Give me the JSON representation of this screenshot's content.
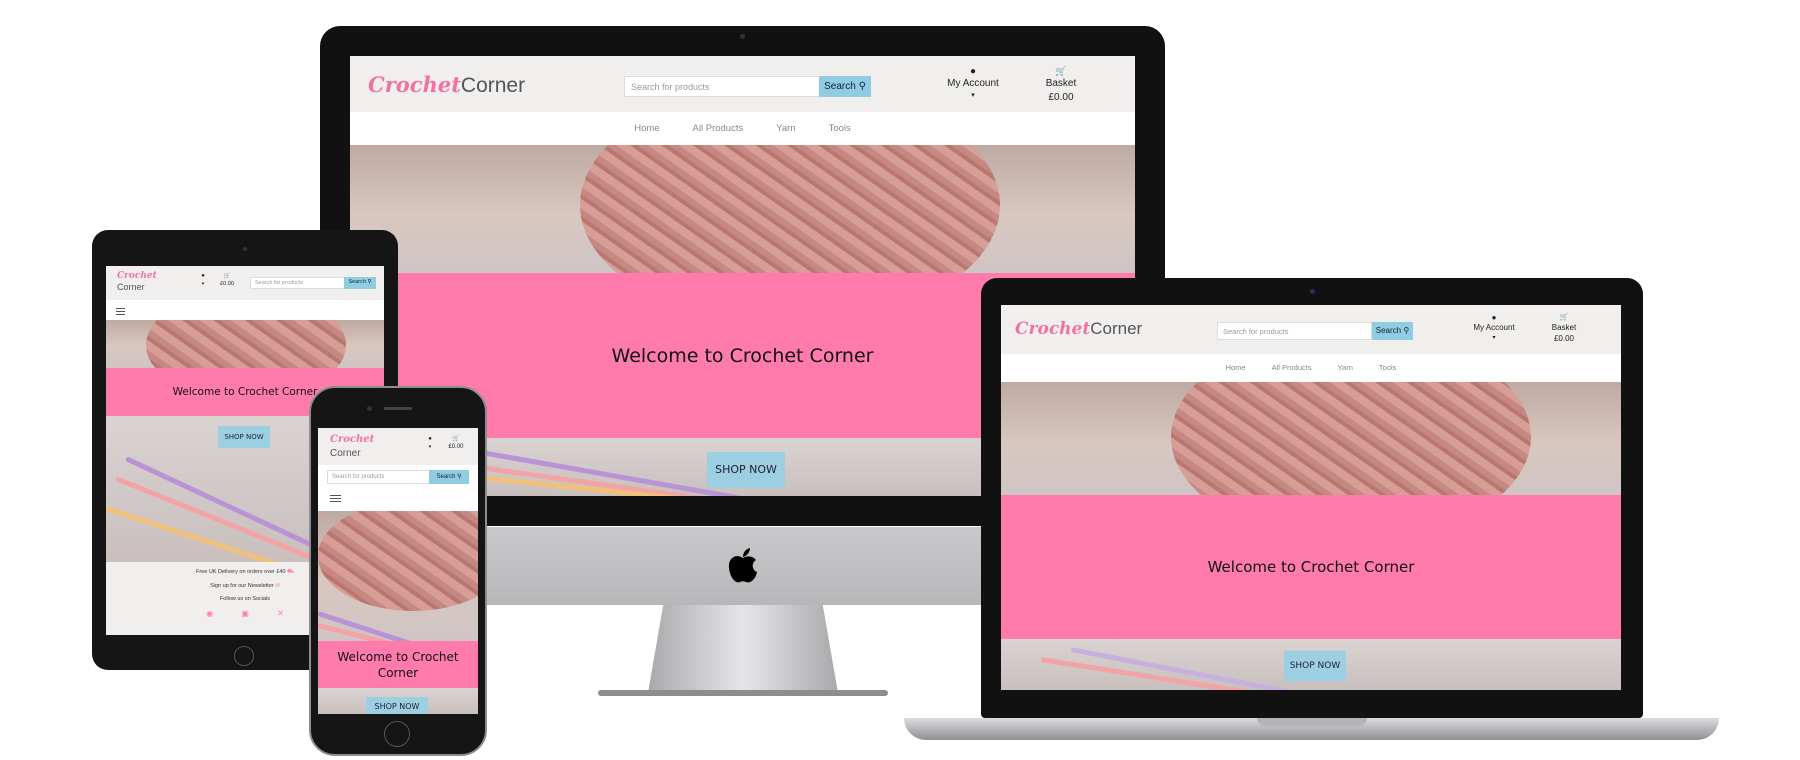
{
  "brand": {
    "name_part1": "Crochet",
    "name_part2": "Corner"
  },
  "header": {
    "search_placeholder": "Search for products",
    "search_button": "Search",
    "account_label": "My Account",
    "account_caret": "▾",
    "basket_label": "Basket",
    "basket_total": "£0.00"
  },
  "nav": {
    "items": [
      "Home",
      "All Products",
      "Yarn",
      "Tools"
    ]
  },
  "hero": {
    "welcome": "Welcome to Crochet Corner",
    "shop_now": "SHOP NOW"
  },
  "footer": {
    "lines": [
      "Free UK Delivery on orders over £40",
      "Sign up for our Newsletter",
      "Follow us on Socials"
    ],
    "social_icons": [
      "facebook-icon",
      "instagram-icon",
      "x-icon"
    ]
  },
  "colors": {
    "pink": "#ff7bac",
    "logo_pink": "#f072a5",
    "button_blue": "#9dcfe2",
    "header_bg": "#f1efed"
  }
}
